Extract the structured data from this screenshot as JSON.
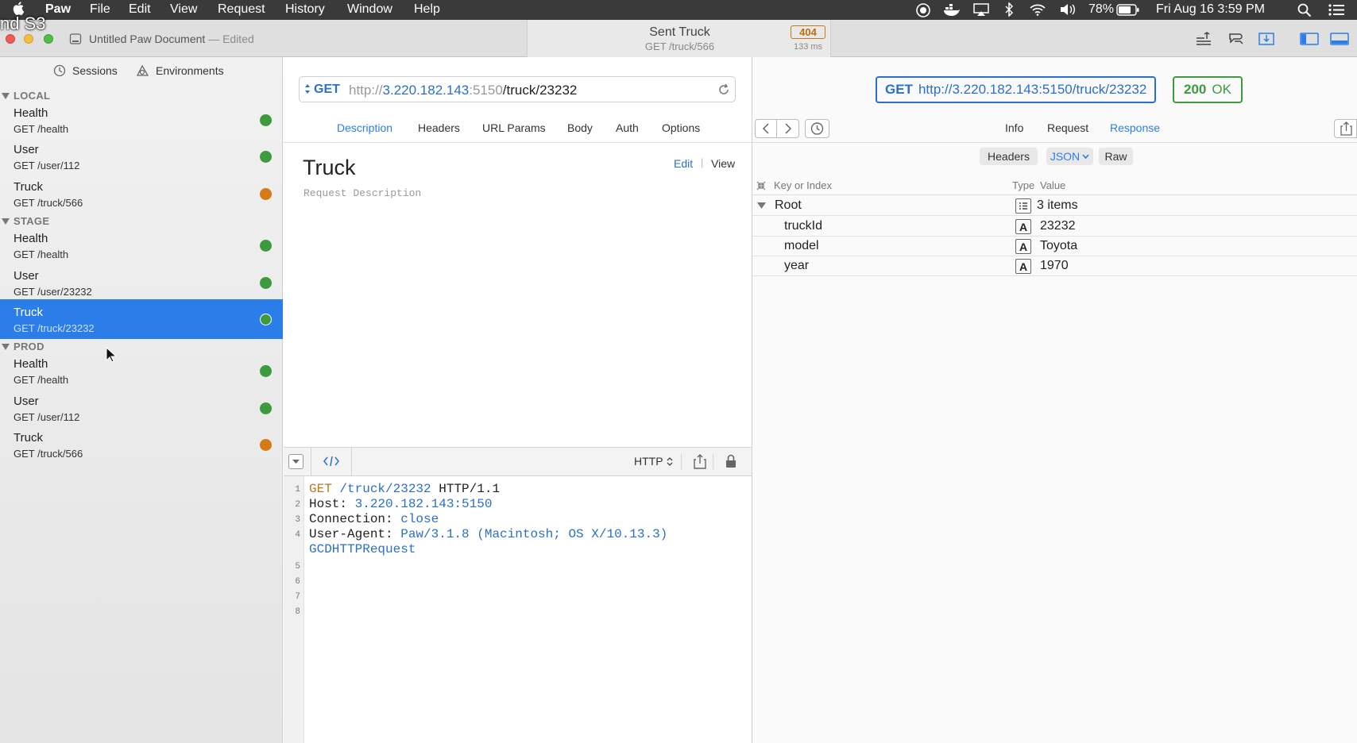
{
  "menubar": {
    "app": "Paw",
    "items": [
      "File",
      "Edit",
      "View",
      "Request",
      "History",
      "Window",
      "Help"
    ],
    "battery": "78%",
    "datetime": "Fri Aug 16  3:59 PM"
  },
  "overlay_text": "nd S3",
  "window": {
    "title": "Untitled Paw Document",
    "title_suffix": "— Edited",
    "sent_title": "Sent Truck",
    "sent_path": "GET /truck/566",
    "sent_status": "404",
    "sent_time": "133 ms"
  },
  "sidebar": {
    "tabs": [
      {
        "label": "Sessions"
      },
      {
        "label": "Environments"
      }
    ],
    "groups": [
      {
        "name": "LOCAL",
        "items": [
          {
            "name": "Health",
            "path": "GET /health",
            "status": "ok"
          },
          {
            "name": "User",
            "path": "GET /user/112",
            "status": "ok"
          },
          {
            "name": "Truck",
            "path": "GET /truck/566",
            "status": "warn"
          }
        ]
      },
      {
        "name": "STAGE",
        "items": [
          {
            "name": "Health",
            "path": "GET /health",
            "status": "ok"
          },
          {
            "name": "User",
            "path": "GET /user/23232",
            "status": "ok"
          },
          {
            "name": "Truck",
            "path": "GET /truck/23232",
            "status": "ok",
            "selected": true
          }
        ]
      },
      {
        "name": "PROD",
        "items": [
          {
            "name": "Health",
            "path": "GET /health",
            "status": "ok"
          },
          {
            "name": "User",
            "path": "GET /user/112",
            "status": "ok"
          },
          {
            "name": "Truck",
            "path": "GET /truck/566",
            "status": "warn"
          }
        ]
      }
    ]
  },
  "request": {
    "method": "GET",
    "url_scheme": "http://",
    "url_host": "3.220.182.143",
    "url_port": ":5150",
    "url_path": "/truck/23232",
    "tabs": [
      "Description",
      "Headers",
      "URL Params",
      "Body",
      "Auth",
      "Options"
    ],
    "active_tab": "Description",
    "title": "Truck",
    "description_placeholder": "Request Description",
    "edit_label": "Edit",
    "view_label": "View"
  },
  "code_panel": {
    "format": "HTTP",
    "lines": [
      {
        "n": "1",
        "parts": [
          [
            "kw",
            "GET "
          ],
          [
            "bl",
            "/truck/23232"
          ],
          [
            "",
            "HTTP/1.1"
          ]
        ]
      },
      {
        "n": "2",
        "parts": [
          [
            "",
            "Host: "
          ],
          [
            "bl",
            "3.220.182.143:5150"
          ]
        ]
      },
      {
        "n": "3",
        "parts": [
          [
            "",
            "Connection: "
          ],
          [
            "bl",
            "close"
          ]
        ]
      },
      {
        "n": "4",
        "parts": [
          [
            "",
            "User-Agent: "
          ],
          [
            "bl",
            "Paw/3.1.8 (Macintosh; OS X/10.13.3)"
          ]
        ]
      },
      {
        "n": "",
        "parts": [
          [
            "bl",
            "GCDHTTPRequest"
          ]
        ]
      },
      {
        "n": "5",
        "parts": []
      },
      {
        "n": "6",
        "parts": []
      },
      {
        "n": "7",
        "parts": []
      },
      {
        "n": "8",
        "parts": []
      }
    ]
  },
  "response": {
    "request_line_method": "GET",
    "request_line_url": "http://3.220.182.143:5150/truck/23232",
    "status_code": "200",
    "status_text": "OK",
    "tabs": [
      "Info",
      "Request",
      "Response"
    ],
    "active_tab": "Response",
    "views": [
      "Headers",
      "JSON",
      "Raw"
    ],
    "active_view": "JSON",
    "columns": {
      "key": "Key or Index",
      "type": "Type",
      "value": "Value"
    },
    "root": {
      "key": "Root",
      "value": "3 items"
    },
    "rows": [
      {
        "key": "truckId",
        "type": "A",
        "value": "23232"
      },
      {
        "key": "model",
        "type": "A",
        "value": "Toyota"
      },
      {
        "key": "year",
        "type": "A",
        "value": "1970"
      }
    ]
  },
  "colors": {
    "accent": "#2b7de9",
    "ok": "#3e9a3f",
    "warn": "#d67a16",
    "method": "#2b6fc9"
  }
}
